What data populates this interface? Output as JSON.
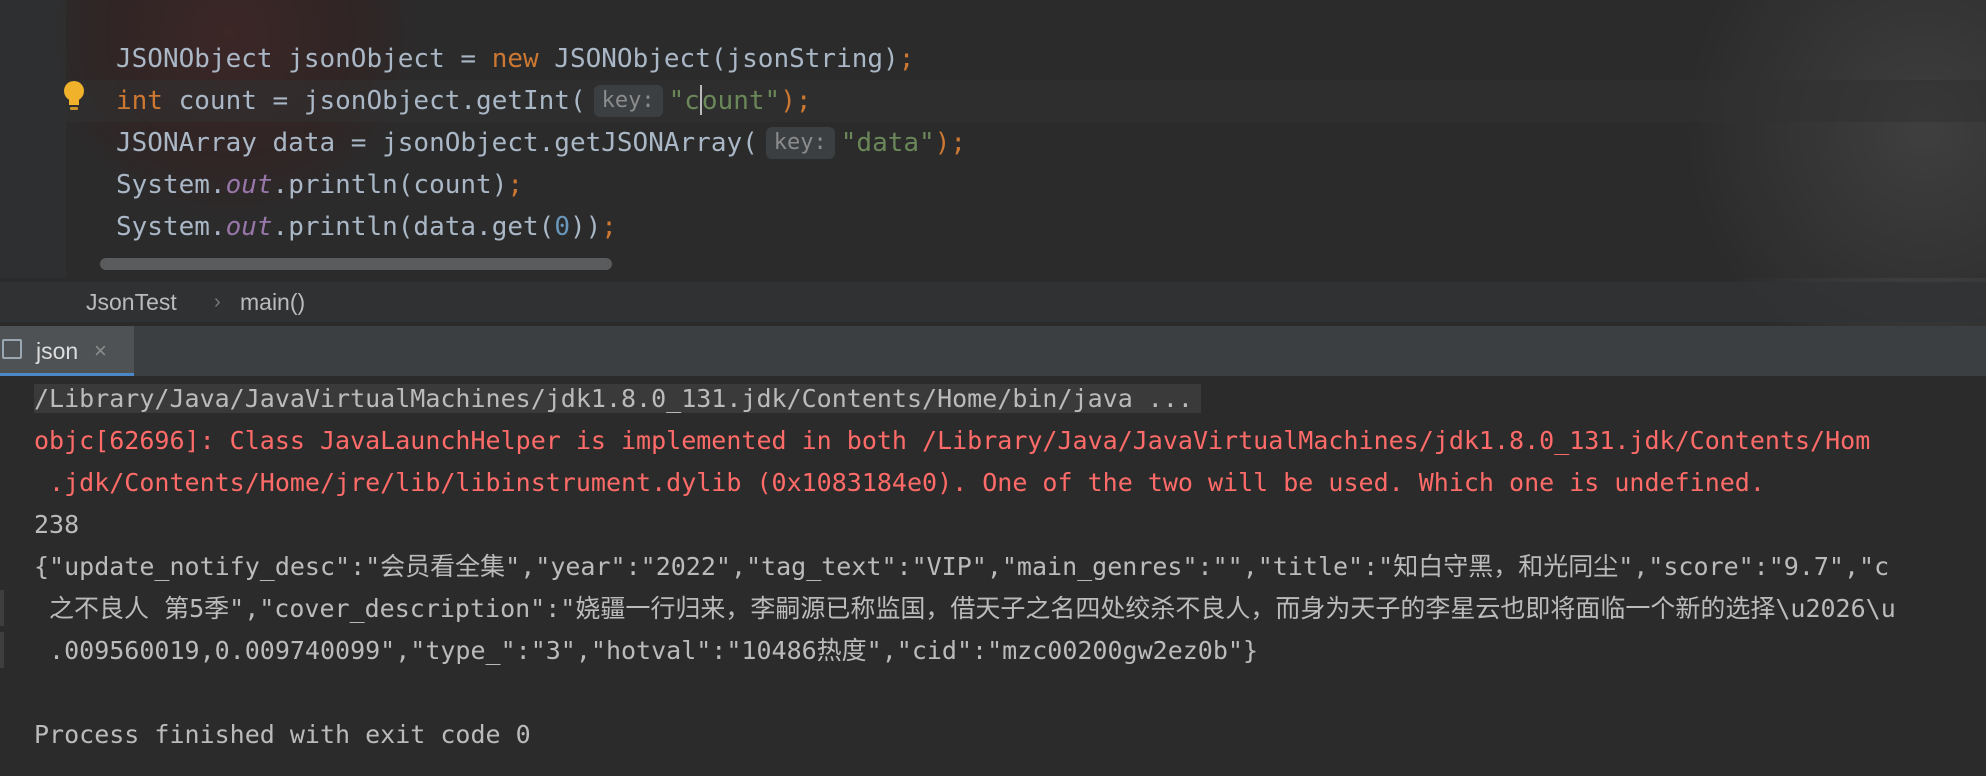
{
  "editor": {
    "lines": [
      {
        "plain1": "JSONObject jsonObject = ",
        "kw": "new",
        "plain2": " JSONObject(jsonString)",
        "semi": ";"
      },
      {
        "kw": "int",
        "plain1": " count = jsonObject.getInt(",
        "hint": "key:",
        "str_pre": "\"c",
        "str_post": "ount\"",
        "close": ");"
      },
      {
        "plain1": "JSONArray data = jsonObject.getJSONArray(",
        "hint": "key:",
        "str": "\"data\"",
        "close": ");"
      },
      {
        "plain1": "System.",
        "field": "out",
        "plain2": ".println(count)",
        "semi": ";"
      },
      {
        "plain1": "System.",
        "field": "out",
        "plain2": ".println(data.get(",
        "num": "0",
        "plain3": "))",
        "semi": ";"
      }
    ],
    "bulb_icon": "lightbulb-icon"
  },
  "breadcrumb": {
    "items": [
      "JsonTest",
      "main()"
    ],
    "separator": "›"
  },
  "run_panel": {
    "tab_label": "json",
    "tab_close": "×",
    "icon": "console-icon"
  },
  "console": {
    "lines": [
      "/Library/Java/JavaVirtualMachines/jdk1.8.0_131.jdk/Contents/Home/bin/java ...",
      "objc[62696]: Class JavaLaunchHelper is implemented in both /Library/Java/JavaVirtualMachines/jdk1.8.0_131.jdk/Contents/Hom",
      " .jdk/Contents/Home/jre/lib/libinstrument.dylib (0x1083184e0). One of the two will be used. Which one is undefined.",
      "238",
      "{\"update_notify_desc\":\"会员看全集\",\"year\":\"2022\",\"tag_text\":\"VIP\",\"main_genres\":\"\",\"title\":\"知白守黑，和光同尘\",\"score\":\"9.7\",\"c",
      " 之不良人 第5季\",\"cover_description\":\"娆疆一行归来，李嗣源已称监国，借天子之名四处绞杀不良人，而身为天子的李星云也即将面临一个新的选择\\u2026\\u",
      " .009560019,0.009740099\",\"type_\":\"3\",\"hotval\":\"10486热度\",\"cid\":\"mzc00200gw2ez0b\"}",
      "",
      "Process finished with exit code 0"
    ]
  },
  "colors": {
    "background": "#2b2b2b",
    "keyword": "#cc7832",
    "string": "#6a8759",
    "number": "#6897bb",
    "field": "#9876aa",
    "error": "#ff6b68",
    "text": "#a9b7c6"
  }
}
